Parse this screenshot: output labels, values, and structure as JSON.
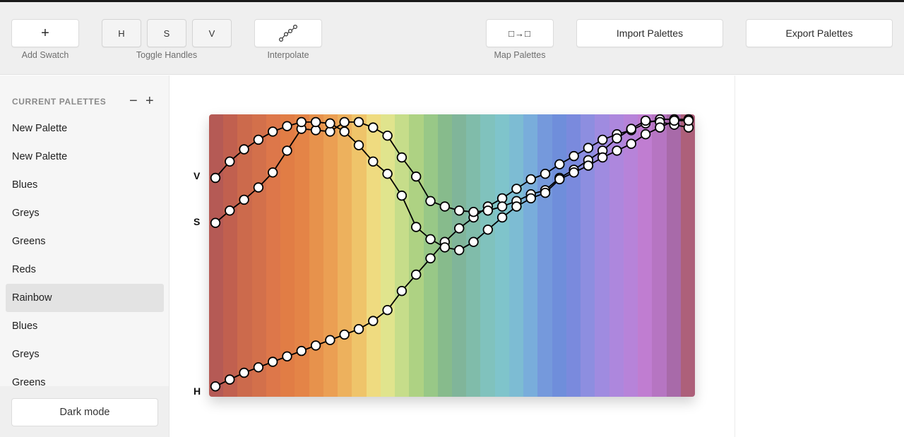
{
  "toolbar": {
    "add_swatch": {
      "icon": "+",
      "label": "Add Swatch"
    },
    "toggle_handles": {
      "buttons": [
        "H",
        "S",
        "V"
      ],
      "label": "Toggle Handles"
    },
    "interpolate": {
      "icon": "interpolate-icon",
      "label": "Interpolate"
    },
    "map_palettes": {
      "icon": "map-palettes-icon",
      "icon_text": "□→□",
      "label": "Map Palettes"
    },
    "import_label": "Import Palettes",
    "export_label": "Export Palettes"
  },
  "sidebar": {
    "header": "CURRENT PALETTES",
    "remove_icon": "−",
    "add_icon": "+",
    "items": [
      {
        "label": "New Palette",
        "selected": false
      },
      {
        "label": "New Palette",
        "selected": false
      },
      {
        "label": "Blues",
        "selected": false
      },
      {
        "label": "Greys",
        "selected": false
      },
      {
        "label": "Greens",
        "selected": false
      },
      {
        "label": "Reds",
        "selected": false
      },
      {
        "label": "Rainbow",
        "selected": true
      },
      {
        "label": "Blues",
        "selected": false
      },
      {
        "label": "Greys",
        "selected": false
      },
      {
        "label": "Greens",
        "selected": false
      }
    ],
    "dark_mode_label": "Dark mode"
  },
  "editor": {
    "axis_labels": {
      "v": "V",
      "s": "S",
      "h": "H"
    },
    "swatches": [
      "#b55a55",
      "#c1604f",
      "#cc6a4c",
      "#d3704b",
      "#dd774a",
      "#e17d45",
      "#e48447",
      "#e7924c",
      "#eb9f53",
      "#edb15d",
      "#efc46a",
      "#efdb80",
      "#e0e48d",
      "#c6dd8a",
      "#aed283",
      "#98c887",
      "#87bb8c",
      "#80b59a",
      "#80bcaa",
      "#80c2bd",
      "#7fc4cb",
      "#7dbcd3",
      "#79addb",
      "#7599dc",
      "#6f8edb",
      "#7a8add",
      "#8d8ee0",
      "#9f8be0",
      "#ad87dd",
      "#b783d9",
      "#c07dd1",
      "#b675c2",
      "#a86aa9",
      "#ad607a"
    ],
    "series": {
      "h": [
        0.02,
        0.045,
        0.07,
        0.09,
        0.11,
        0.13,
        0.15,
        0.17,
        0.19,
        0.21,
        0.23,
        0.26,
        0.3,
        0.37,
        0.43,
        0.49,
        0.55,
        0.6,
        0.64,
        0.68,
        0.71,
        0.745,
        0.78,
        0.8,
        0.835,
        0.865,
        0.895,
        0.925,
        0.945,
        0.96,
        0.985,
        1.0,
        1.0,
        1.0
      ],
      "s": [
        0.62,
        0.665,
        0.705,
        0.75,
        0.805,
        0.885,
        0.965,
        0.96,
        0.955,
        0.99,
        0.99,
        0.97,
        0.94,
        0.86,
        0.79,
        0.7,
        0.68,
        0.665,
        0.66,
        0.665,
        0.68,
        0.7,
        0.725,
        0.74,
        0.785,
        0.815,
        0.85,
        0.885,
        0.93,
        0.965,
        0.995,
        0.99,
        0.98,
        0.97
      ],
      "v": [
        0.785,
        0.845,
        0.89,
        0.925,
        0.955,
        0.975,
        0.99,
        0.99,
        0.985,
        0.955,
        0.905,
        0.845,
        0.8,
        0.72,
        0.605,
        0.56,
        0.53,
        0.52,
        0.55,
        0.595,
        0.64,
        0.68,
        0.71,
        0.73,
        0.78,
        0.805,
        0.83,
        0.86,
        0.885,
        0.91,
        0.945,
        0.97,
        0.995,
        0.995
      ]
    }
  }
}
